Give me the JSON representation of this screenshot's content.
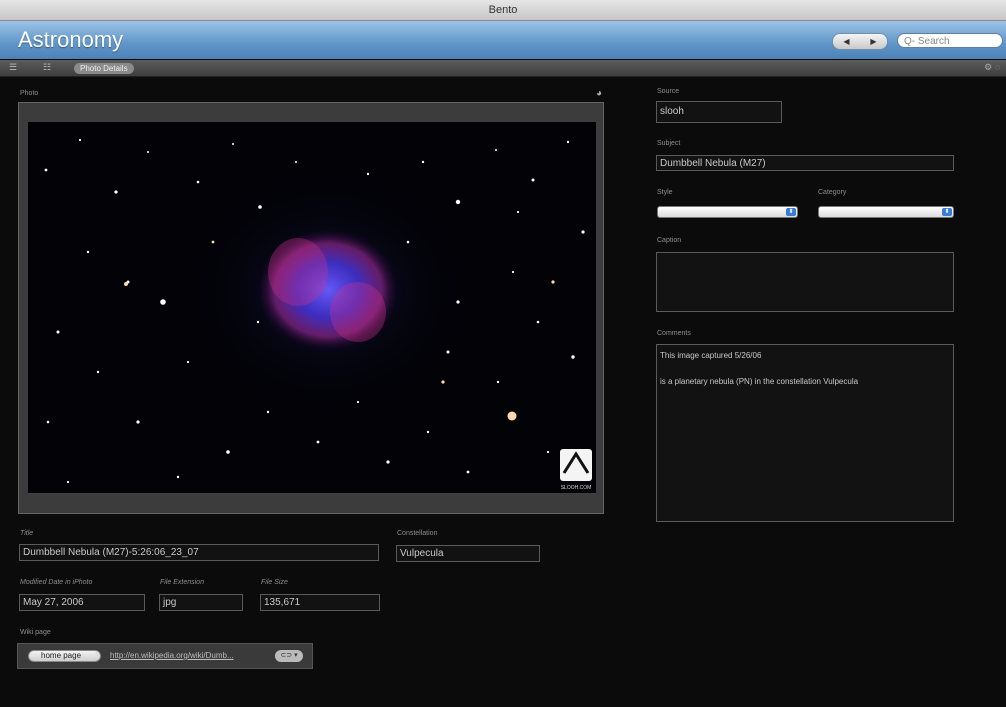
{
  "window": {
    "title": "Bento"
  },
  "app": {
    "title": "Astronomy"
  },
  "nav": {
    "back": "◀",
    "forward": "▶",
    "search_placeholder": "Q- Search"
  },
  "toolbar": {
    "view_list_icon": "list-icon",
    "view_grid_icon": "grid-icon",
    "tab_label": "Photo Details"
  },
  "photo": {
    "label": "Photo",
    "watermark": "SLOOH.COM"
  },
  "fields": {
    "source": {
      "label": "Source",
      "value": "slooh"
    },
    "subject": {
      "label": "Subject",
      "value": "Dumbbell Nebula (M27)"
    },
    "style": {
      "label": "Style",
      "value": ""
    },
    "category": {
      "label": "Category",
      "value": ""
    },
    "caption": {
      "label": "Caption",
      "value": ""
    },
    "comments": {
      "label": "Comments",
      "line1": "This image captured 5/26/06",
      "line2": "is a planetary nebula (PN) in the constellation Vulpecula"
    },
    "title": {
      "label": "Title",
      "value": "Dumbbell Nebula (M27)-5:26:06_23_07"
    },
    "constellation": {
      "label": "Constellation",
      "value": "Vulpecula"
    },
    "modified": {
      "label": "Modified Date in iPhoto",
      "value": "May 27, 2006"
    },
    "extension": {
      "label": "File Extension",
      "value": "jpg"
    },
    "filesize": {
      "label": "File Size",
      "value": "135,671"
    },
    "wiki": {
      "label": "Wiki page",
      "type": "home page",
      "url": "http://en.wikipedia.org/wiki/Dumb...",
      "go": "⊂⊃ ▾"
    }
  },
  "colors": {
    "header": "#5f95c8",
    "background": "#0b0b0b",
    "accent": "#3a7bd8"
  }
}
